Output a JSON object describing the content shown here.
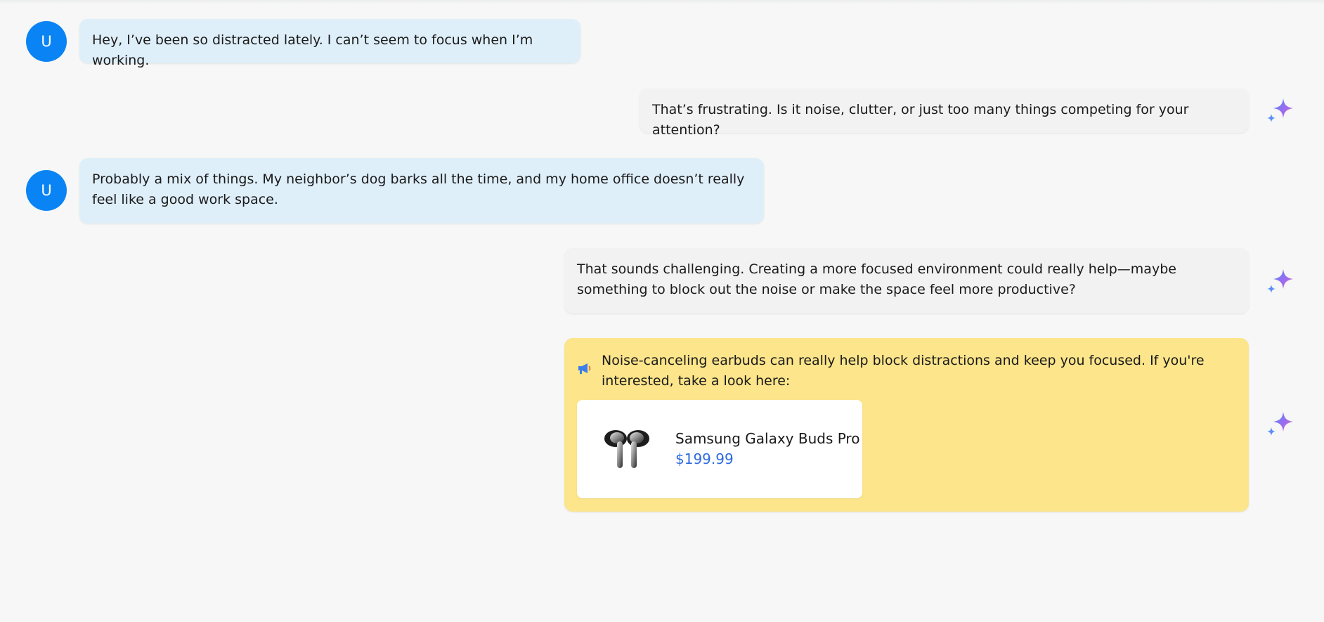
{
  "messages": [
    {
      "role": "user",
      "avatar_letter": "U",
      "text": "Hey, I’ve been so distracted lately. I can’t seem to focus when I’m working."
    },
    {
      "role": "assistant",
      "icon": "sparkle-icon",
      "text": "That’s frustrating. Is it noise, clutter, or just too many things competing for your attention?"
    },
    {
      "role": "user",
      "avatar_letter": "U",
      "text": "Probably a mix of things. My neighbor’s dog barks all the time, and my home office doesn’t really feel like a good work space."
    },
    {
      "role": "assistant",
      "icon": "sparkle-icon",
      "text": "That sounds challenging. Creating a more focused environment could really help—maybe something to block out the noise or make the space feel more productive?"
    },
    {
      "role": "assistant",
      "type": "sponsored",
      "icon": "sparkle-icon",
      "badge_icon": "megaphone-icon",
      "text": "Noise-canceling earbuds can really help block distractions and keep you focused. If you're interested, take a look here:",
      "product": {
        "name": "Samsung Galaxy Buds Pro",
        "price": "$199.99",
        "image_icon": "earbuds-icon"
      }
    }
  ],
  "colors": {
    "background": "#f6f7f6",
    "user_avatar": "#0a84f5",
    "user_bubble": "#dfeffa",
    "assistant_bubble": "#f1f2f1",
    "ad_bubble": "#fce58a",
    "price": "#2f6be0"
  }
}
